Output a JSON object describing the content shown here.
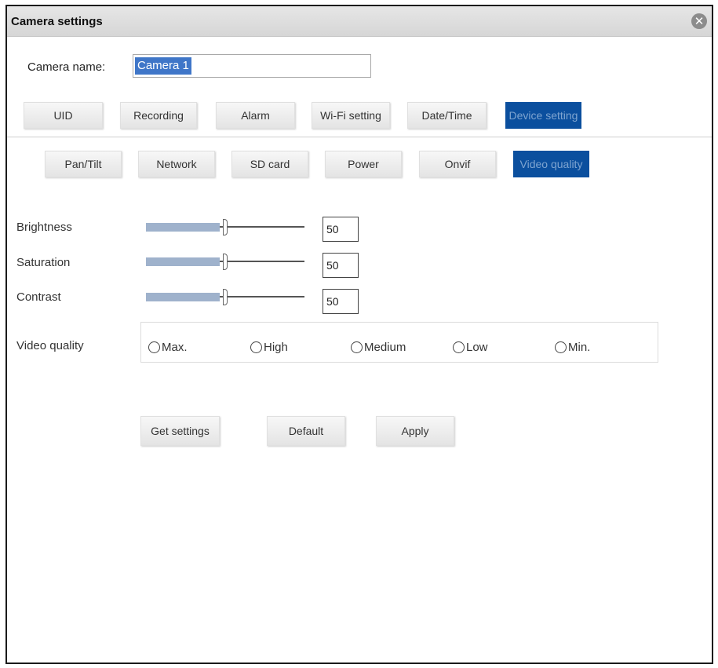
{
  "window": {
    "title": "Camera settings"
  },
  "camera_name": {
    "label": "Camera name:",
    "value": "Camera 1"
  },
  "main_tabs": [
    {
      "label": "UID"
    },
    {
      "label": "Recording"
    },
    {
      "label": "Alarm"
    },
    {
      "label": "Wi-Fi setting"
    },
    {
      "label": "Date/Time"
    },
    {
      "label": "Device setting",
      "active": true
    }
  ],
  "sub_tabs": [
    {
      "label": "Pan/Tilt"
    },
    {
      "label": "Network"
    },
    {
      "label": "SD card"
    },
    {
      "label": "Power"
    },
    {
      "label": "Onvif"
    },
    {
      "label": "Video quality",
      "active": true
    }
  ],
  "image": {
    "brightness": {
      "label": "Brightness",
      "value": "50"
    },
    "saturation": {
      "label": "Saturation",
      "value": "50"
    },
    "contrast": {
      "label": "Contrast",
      "value": "50"
    }
  },
  "video_quality": {
    "label": "Video quality",
    "options": [
      "Max.",
      "High",
      "Medium",
      "Low",
      "Min."
    ]
  },
  "actions": {
    "get_settings": "Get settings",
    "default": "Default",
    "apply": "Apply"
  },
  "colors": {
    "accent": "#0b4f9e",
    "slider_fill": "#9fb2cc"
  },
  "icons": {
    "close": "close-icon"
  }
}
